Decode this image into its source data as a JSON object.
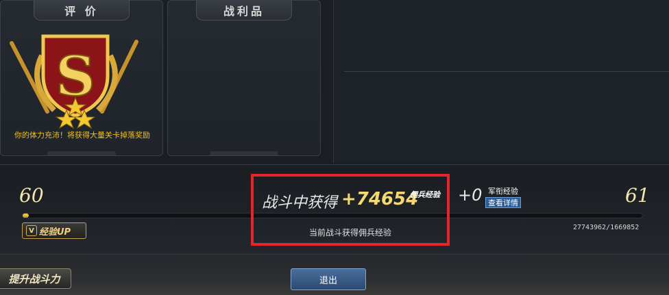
{
  "rating_panel": {
    "title": "评 价",
    "grade": "S",
    "stamina_message": "你的体力充沛！将获得大量关卡掉落奖励"
  },
  "loot_panel": {
    "title": "战利品"
  },
  "experience": {
    "current_level": "60",
    "next_level": "61",
    "progress_fraction": 0.01,
    "exp_up_badge": "经验UP",
    "counter": "27743962/1669852"
  },
  "battle": {
    "label": "战斗中获得",
    "amount": "+74654",
    "amount_tag": "佣兵经验",
    "subtitle": "当前战斗获得佣兵经验"
  },
  "rank": {
    "amount": "+0",
    "label": "军衔经验",
    "detail_button": "查看详情"
  },
  "buttons": {
    "power": "提升战斗力",
    "exit": "退出"
  },
  "colors": {
    "highlight_box": "#e8242b",
    "gold": "#f4d870",
    "stamina_text": "#f0c020"
  }
}
